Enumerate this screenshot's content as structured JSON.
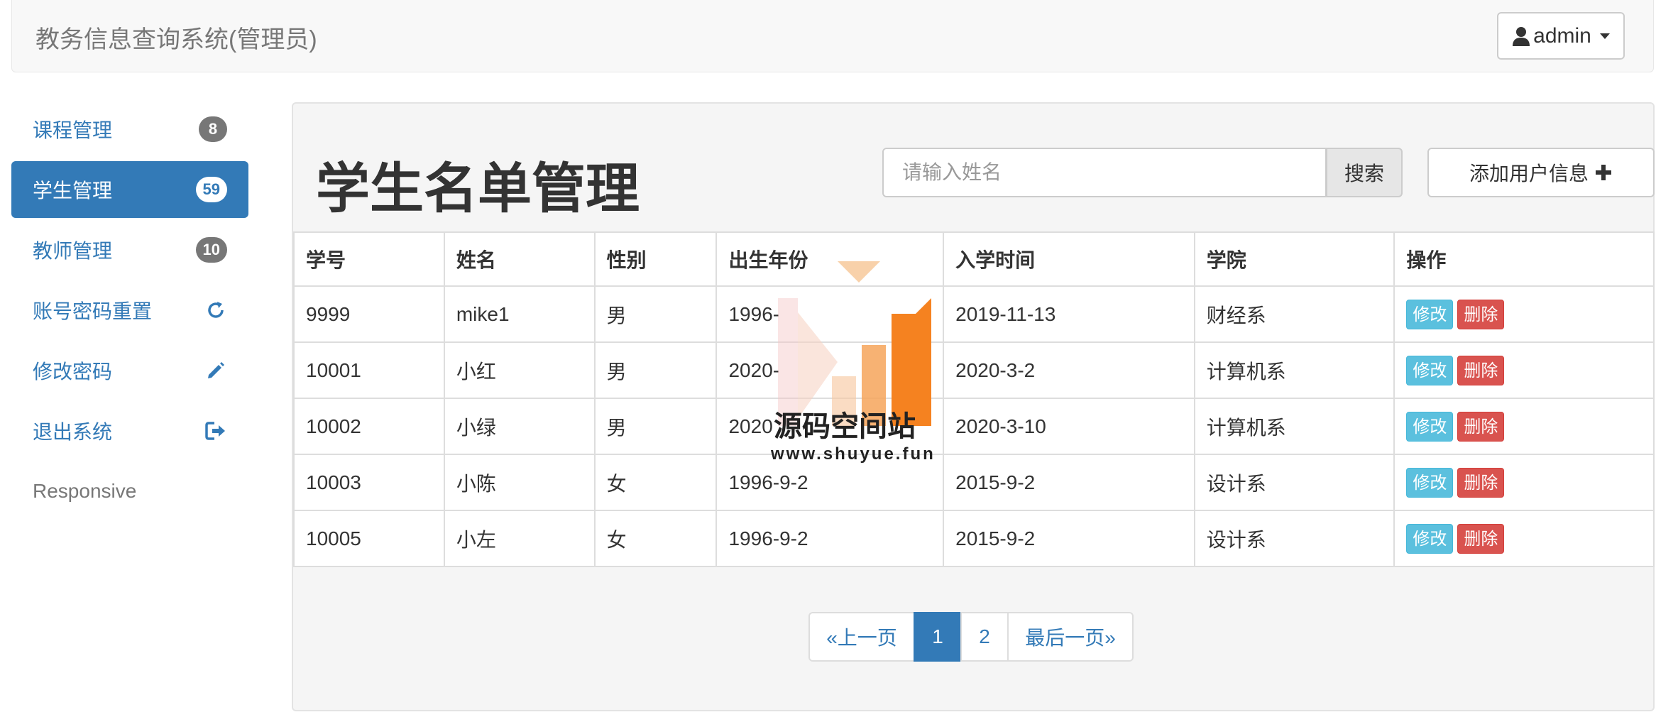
{
  "navbar": {
    "brand": "教务信息查询系统(管理员)",
    "user_label": "admin"
  },
  "sidebar": {
    "items": [
      {
        "label": "课程管理",
        "badge": "8"
      },
      {
        "label": "学生管理",
        "badge": "59",
        "active": true
      },
      {
        "label": "教师管理",
        "badge": "10"
      },
      {
        "label": "账号密码重置",
        "icon": "refresh-icon"
      },
      {
        "label": "修改密码",
        "icon": "pencil-icon"
      },
      {
        "label": "退出系统",
        "icon": "logout-icon"
      },
      {
        "label": "Responsive"
      }
    ]
  },
  "main": {
    "title": "学生名单管理",
    "search": {
      "placeholder": "请输入姓名",
      "button": "搜索"
    },
    "add_button": "添加用户信息",
    "table": {
      "headers": [
        "学号",
        "姓名",
        "性别",
        "出生年份",
        "入学时间",
        "学院",
        "操作"
      ],
      "rows": [
        [
          "9999",
          "mike1",
          "男",
          "1996-",
          "2019-11-13",
          "财经系"
        ],
        [
          "10001",
          "小红",
          "男",
          "2020-",
          "2020-3-2",
          "计算机系"
        ],
        [
          "10002",
          "小绿",
          "男",
          "2020",
          "2020-3-10",
          "计算机系"
        ],
        [
          "10003",
          "小陈",
          "女",
          "1996-9-2",
          "2015-9-2",
          "设计系"
        ],
        [
          "10005",
          "小左",
          "女",
          "1996-9-2",
          "2015-9-2",
          "设计系"
        ]
      ],
      "edit_label": "修改",
      "delete_label": "删除"
    },
    "pagination": {
      "prev": "«上一页",
      "pages": [
        "1",
        "2"
      ],
      "current": "1",
      "last": "最后一页»"
    }
  },
  "watermark": {
    "text": "源码空间站",
    "url": "www.shuyue.fun"
  },
  "colors": {
    "primary": "#337ab7",
    "info": "#5bc0de",
    "danger": "#d9534f",
    "panel": "#f5f5f5"
  }
}
